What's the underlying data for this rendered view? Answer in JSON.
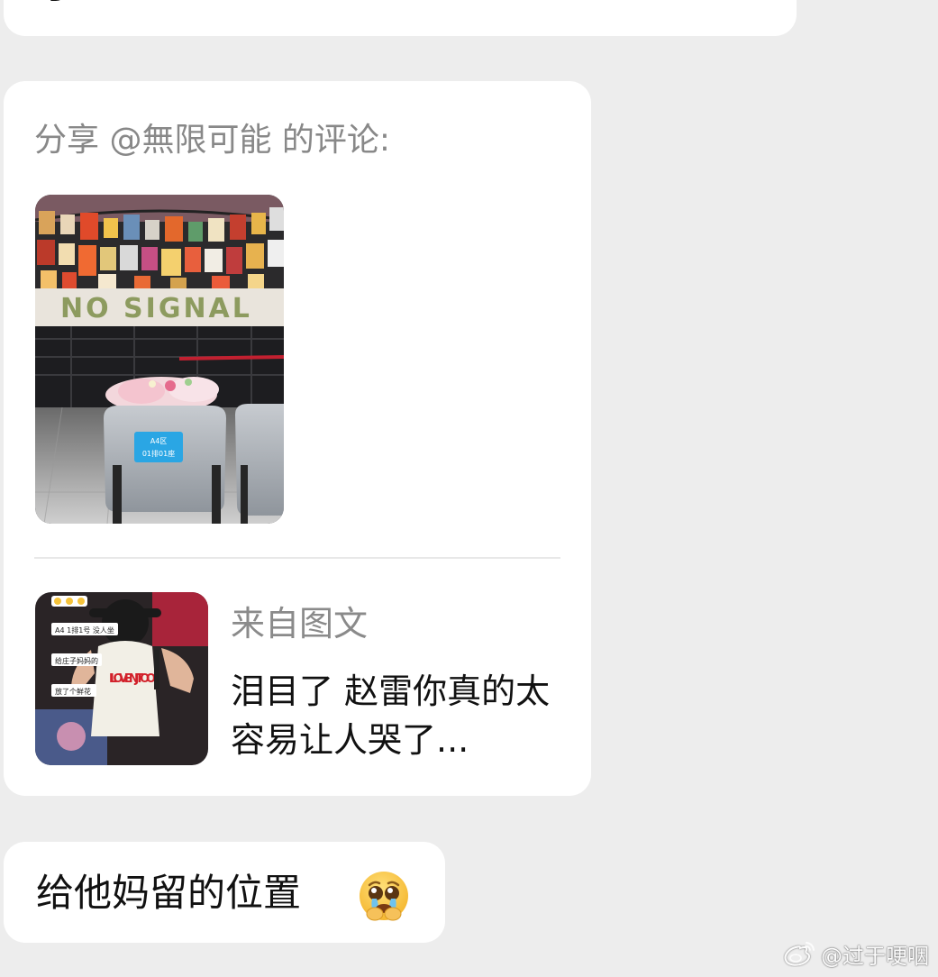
{
  "top_bubble": {
    "cut_glyph": "了"
  },
  "share_card": {
    "title": "分享 @無限可能 的评论:",
    "photo": {
      "banner_text": "NO SIGNAL",
      "seat_label_line1": "A4区",
      "seat_label_line2": "01排01座"
    },
    "source_label": "来自图文",
    "preview_text": "泪目了 赵雷你真的太容易让人哭了...",
    "thumbnail": {
      "caption_lines": [
        "A4 1排1号 没人坐",
        "给庄子妈妈的",
        "放了个鲜花"
      ],
      "shirt_text": "I LOVE NJ TOO"
    }
  },
  "message": {
    "text": "给他妈留的位置",
    "emoji": "pleading-face-with-tears"
  },
  "watermark": {
    "text": "@过于哽咽",
    "icon": "weibo-logo-icon"
  },
  "colors": {
    "background": "#ededed",
    "bubble": "#ffffff",
    "muted_text": "#888888",
    "text": "#111111"
  }
}
